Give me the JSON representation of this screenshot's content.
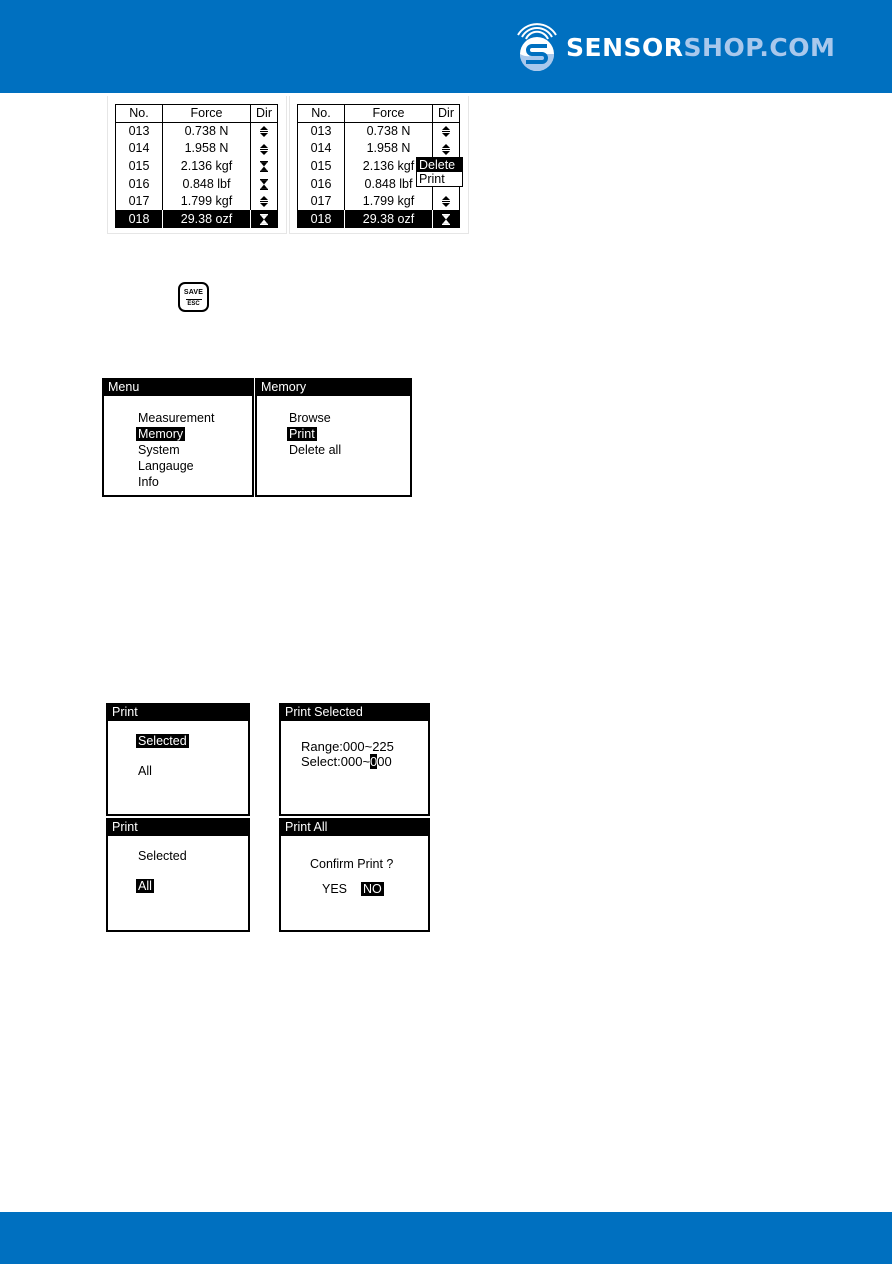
{
  "header": {
    "brand_part1": "SENSOR",
    "brand_part2": "SHOP.COM",
    "logo_icon": "sensor-wave-s-icon",
    "colors": {
      "band": "#0070c0",
      "brand_light": "#a9c8ec",
      "brand_white": "#ffffff"
    }
  },
  "tables": {
    "columns": [
      "No.",
      "Force",
      "Dir"
    ],
    "left": {
      "rows": [
        {
          "no": "013",
          "force": "0.738 N",
          "dir": "both-arrows-icon"
        },
        {
          "no": "014",
          "force": "1.958 N",
          "dir": "both-arrows-icon"
        },
        {
          "no": "015",
          "force": "2.136 kgf",
          "dir": "hourglass-icon"
        },
        {
          "no": "016",
          "force": "0.848 lbf",
          "dir": "hourglass-icon"
        },
        {
          "no": "017",
          "force": "1.799 kgf",
          "dir": "both-arrows-icon"
        },
        {
          "no": "018",
          "force": "29.38 ozf",
          "dir": "hourglass-icon",
          "selected": true
        }
      ]
    },
    "right": {
      "rows": [
        {
          "no": "013",
          "force": "0.738 N",
          "dir": "both-arrows-icon"
        },
        {
          "no": "014",
          "force": "1.958 N",
          "dir": "both-arrows-icon"
        },
        {
          "no": "015",
          "force": "2.136 kgf",
          "dir": ""
        },
        {
          "no": "016",
          "force": "0.848 lbf",
          "dir": ""
        },
        {
          "no": "017",
          "force": "1.799 kgf",
          "dir": "both-arrows-icon"
        },
        {
          "no": "018",
          "force": "29.38 ozf",
          "dir": "hourglass-icon",
          "selected": true
        }
      ],
      "popup": {
        "items": [
          "Delete",
          "Print"
        ],
        "selected": "Delete"
      }
    }
  },
  "save_key": {
    "top": "SAVE",
    "bottom": "ESC"
  },
  "menu_screen": {
    "title": "Menu",
    "items": [
      "Measurement",
      "Memory",
      "System",
      "Langauge",
      "Info"
    ],
    "selected": "Memory"
  },
  "memory_screen": {
    "title": "Memory",
    "items": [
      "Browse",
      "Print",
      "Delete all"
    ],
    "selected": "Print"
  },
  "print_screen_1": {
    "title": "Print",
    "items": [
      "Selected",
      "All"
    ],
    "selected": "Selected"
  },
  "print_selected_screen": {
    "title": "Print Selected",
    "range_label": "Range:",
    "range_value": "000~225",
    "select_label": "Select:",
    "select_from": "000~",
    "select_cursor_digit": "0",
    "select_rest": "00"
  },
  "print_screen_2": {
    "title": "Print",
    "items": [
      "Selected",
      "All"
    ],
    "selected": "All"
  },
  "print_all_screen": {
    "title": "Print All",
    "question": "Confirm Print ?",
    "yes": "YES",
    "no": "NO",
    "selected": "NO"
  }
}
